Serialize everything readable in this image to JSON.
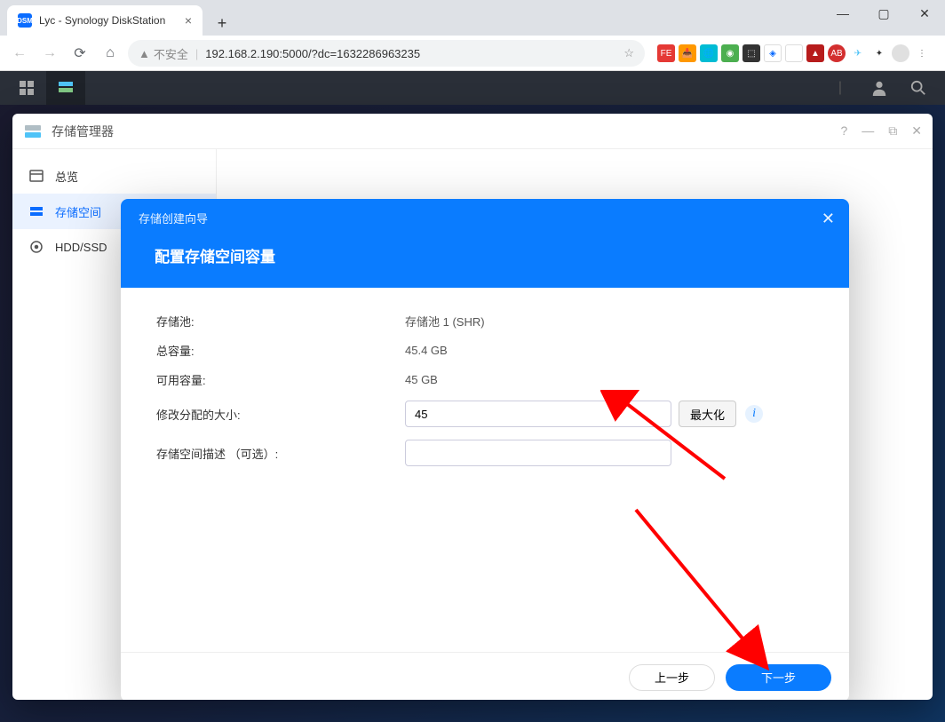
{
  "browser": {
    "tab_title": "Lyc - Synology DiskStation",
    "tab_favicon_text": "DSM",
    "url_warning": "不安全",
    "url": "192.168.2.190:5000/?dc=1632286963235"
  },
  "dsm": {
    "app_title": "存储管理器"
  },
  "sidebar": {
    "items": [
      {
        "label": "总览"
      },
      {
        "label": "存储空间"
      },
      {
        "label": "HDD/SSD"
      }
    ]
  },
  "wizard": {
    "breadcrumb": "存储创建向导",
    "title": "配置存储空间容量",
    "rows": {
      "pool_label": "存储池:",
      "pool_value": "存储池 1 (SHR)",
      "total_label": "总容量:",
      "total_value": "45.4 GB",
      "avail_label": "可用容量:",
      "avail_value": "45 GB",
      "alloc_label": "修改分配的大小:",
      "alloc_value": "45",
      "max_btn": "最大化",
      "desc_label": "存储空间描述 （可选）:",
      "desc_value": ""
    },
    "back_btn": "上一步",
    "next_btn": "下一步"
  }
}
